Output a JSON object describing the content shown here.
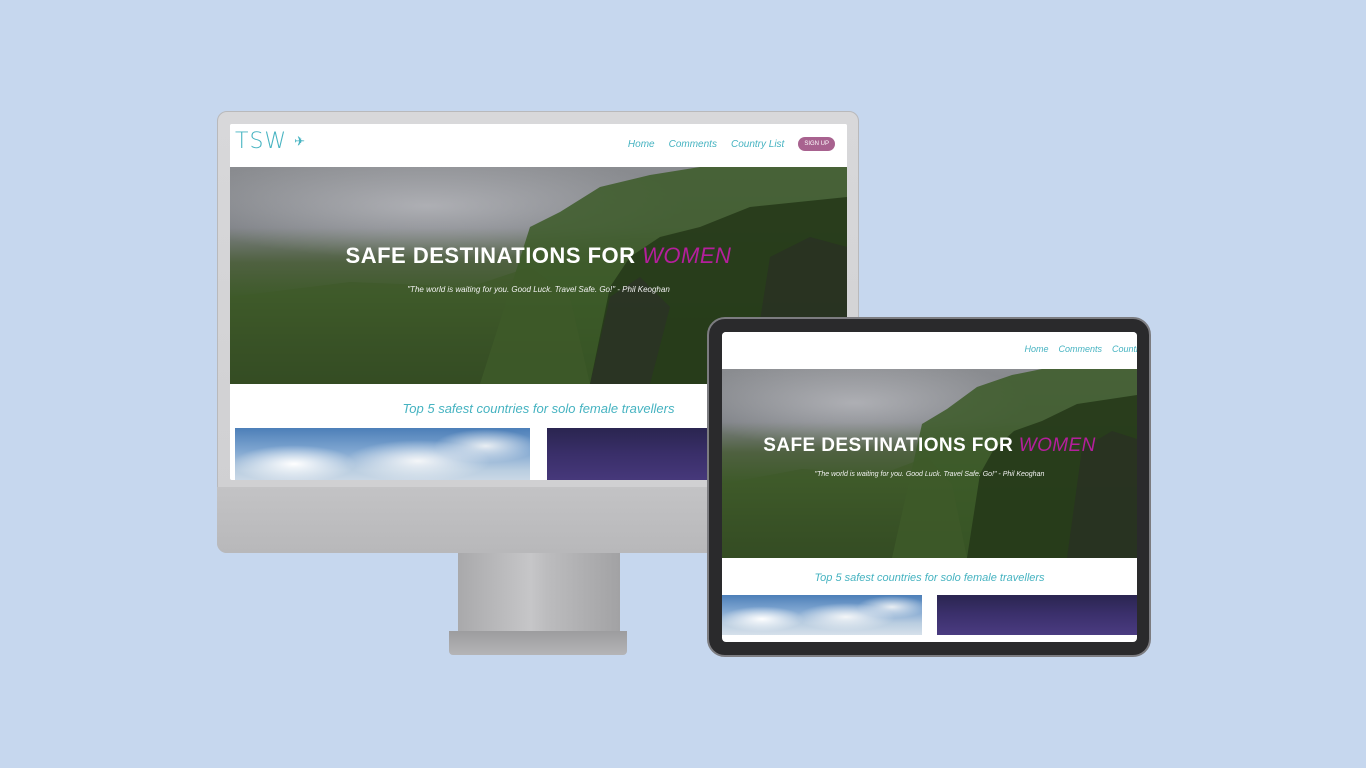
{
  "site": {
    "logo_text": "TSW",
    "nav": {
      "home": "Home",
      "comments": "Comments",
      "country_list": "Country List",
      "country_list_cut": "Countr",
      "signup": "SIGN UP"
    },
    "hero": {
      "title_main": "SAFE DESTINATIONS FOR",
      "title_accent": "WOMEN",
      "quote": "\"The world is waiting for you. Good Luck. Travel Safe. Go!\" - Phil Keoghan"
    },
    "section_title": "Top 5 safest countries for solo female travellers"
  },
  "colors": {
    "background": "#c6d7ee",
    "brand_teal": "#46b3c1",
    "accent_magenta": "#b41f9c",
    "signup_purple": "#a8628f"
  },
  "icons": {
    "logo": "airplane-icon"
  }
}
